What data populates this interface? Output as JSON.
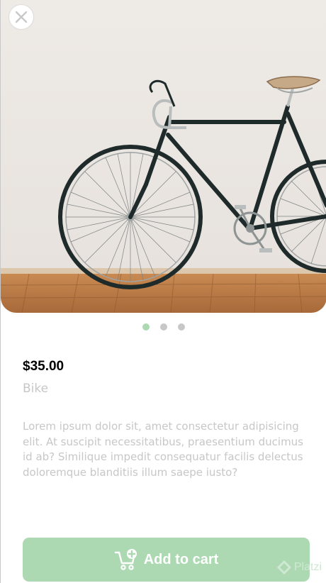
{
  "product": {
    "price": "$35.00",
    "name": "Bike",
    "description": "Lorem ipsum dolor sit, amet consectetur adipisicing elit. At suscipit necessitatibus, praesentium ducimus id ab? Similique impedit consequatur facilis delectus doloremque blanditiis illum saepe iusto?",
    "image_alt": "Bike"
  },
  "carousel": {
    "total": 3,
    "active_index": 0
  },
  "actions": {
    "add_to_cart_label": "Add to cart",
    "close_icon": "close-icon",
    "cart_icon": "cart-plus-icon"
  },
  "watermark": {
    "text": "Platzi"
  },
  "colors": {
    "accent": "#acd9b2",
    "muted_text": "#c7c7c7",
    "price_text": "#000000"
  }
}
